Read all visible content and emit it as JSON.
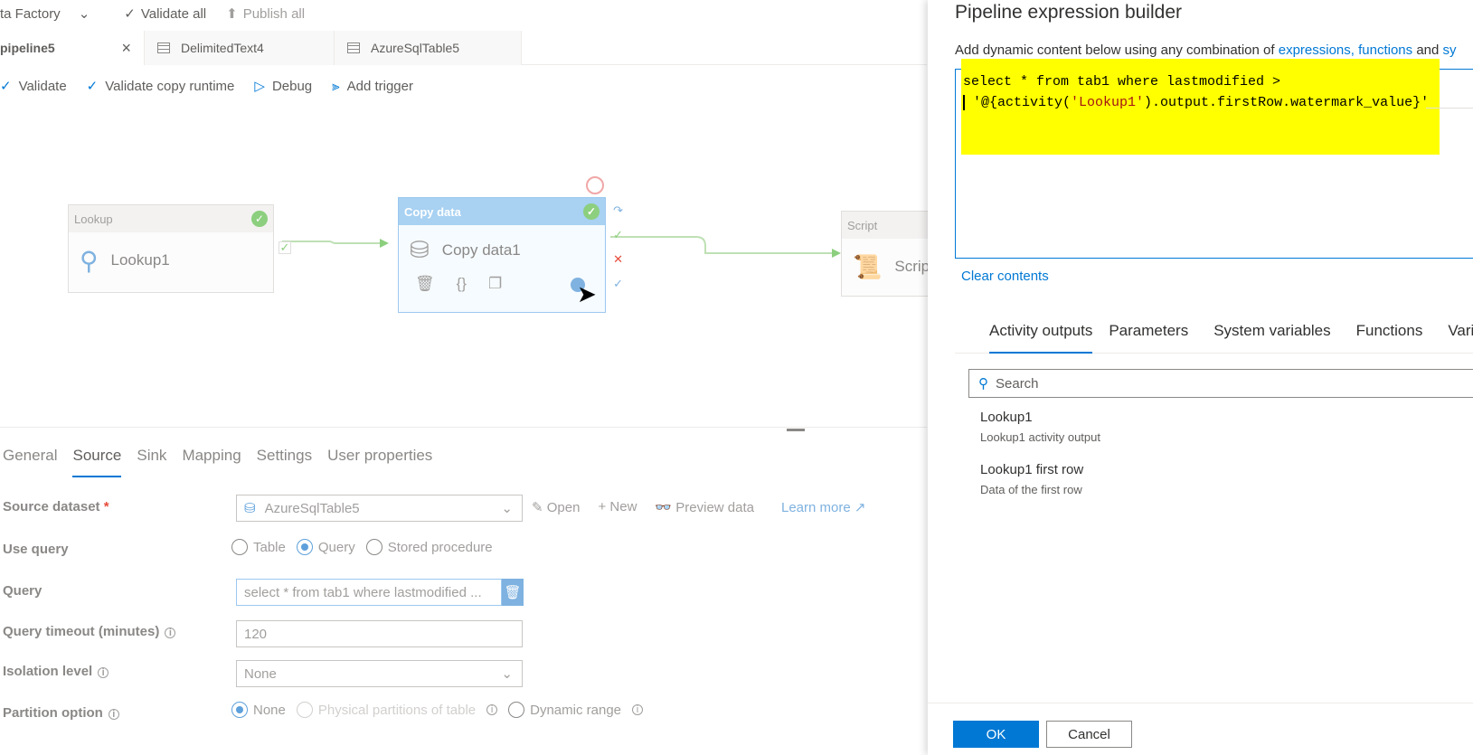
{
  "topbar": {
    "factory_label": "ta Factory",
    "validate_all": "Validate all",
    "publish_all": "Publish all"
  },
  "tabs": [
    {
      "label": "pipeline5",
      "close": "×"
    },
    {
      "label": "DelimitedText4"
    },
    {
      "label": "AzureSqlTable5"
    }
  ],
  "toolbar": {
    "validate": "Validate",
    "validate_copy_runtime": "Validate copy runtime",
    "debug": "Debug",
    "add_trigger": "Add trigger"
  },
  "canvas": {
    "lookup_node": {
      "type": "Lookup",
      "name": "Lookup1"
    },
    "copy_node": {
      "type": "Copy data",
      "name": "Copy data1"
    },
    "script_node": {
      "type": "Script",
      "name": "Scrip"
    }
  },
  "bottom_tabs": [
    "General",
    "Source",
    "Sink",
    "Mapping",
    "Settings",
    "User properties"
  ],
  "active_bottom_tab": "Source",
  "source": {
    "dataset_label": "Source dataset",
    "required_mark": "*",
    "dataset_value": "AzureSqlTable5",
    "open": "Open",
    "new": "New",
    "preview": "Preview data",
    "learn_more": "Learn more",
    "use_query_label": "Use query",
    "use_query_options": [
      "Table",
      "Query",
      "Stored procedure"
    ],
    "use_query_selected": "Query",
    "query_label": "Query",
    "query_value": "select * from tab1 where lastmodified ...",
    "timeout_label": "Query timeout (minutes)",
    "timeout_value": "120",
    "isolation_label": "Isolation level",
    "isolation_value": "None",
    "partition_label": "Partition option",
    "partition_options": [
      "None",
      "Physical partitions of table",
      "Dynamic range"
    ],
    "partition_selected": "None"
  },
  "panel": {
    "title": "Pipeline expression builder",
    "desc_prefix": "Add dynamic content below using any combination of",
    "desc_link": "expressions, functions",
    "desc_and": "and",
    "desc_sy": "sy",
    "code_line1": "select * from tab1 where lastmodified >",
    "code_line2_pre": " '@{activity(",
    "code_line2_str": "'Lookup1'",
    "code_line2_post": ").output.firstRow.watermark_value}'",
    "clear": "Clear contents",
    "tabs": [
      "Activity outputs",
      "Parameters",
      "System variables",
      "Functions",
      "Vari"
    ],
    "active_tab": "Activity outputs",
    "search_placeholder": "Search",
    "entries": [
      {
        "title": "Lookup1",
        "subtitle": "Lookup1 activity output"
      },
      {
        "title": "Lookup1 first row",
        "subtitle": "Data of the first row"
      }
    ],
    "ok": "OK",
    "cancel": "Cancel"
  },
  "colors": {
    "accent": "#0078d4",
    "highlight": "#ffff00",
    "success": "#8ccf7e",
    "error": "#e74c3c"
  }
}
